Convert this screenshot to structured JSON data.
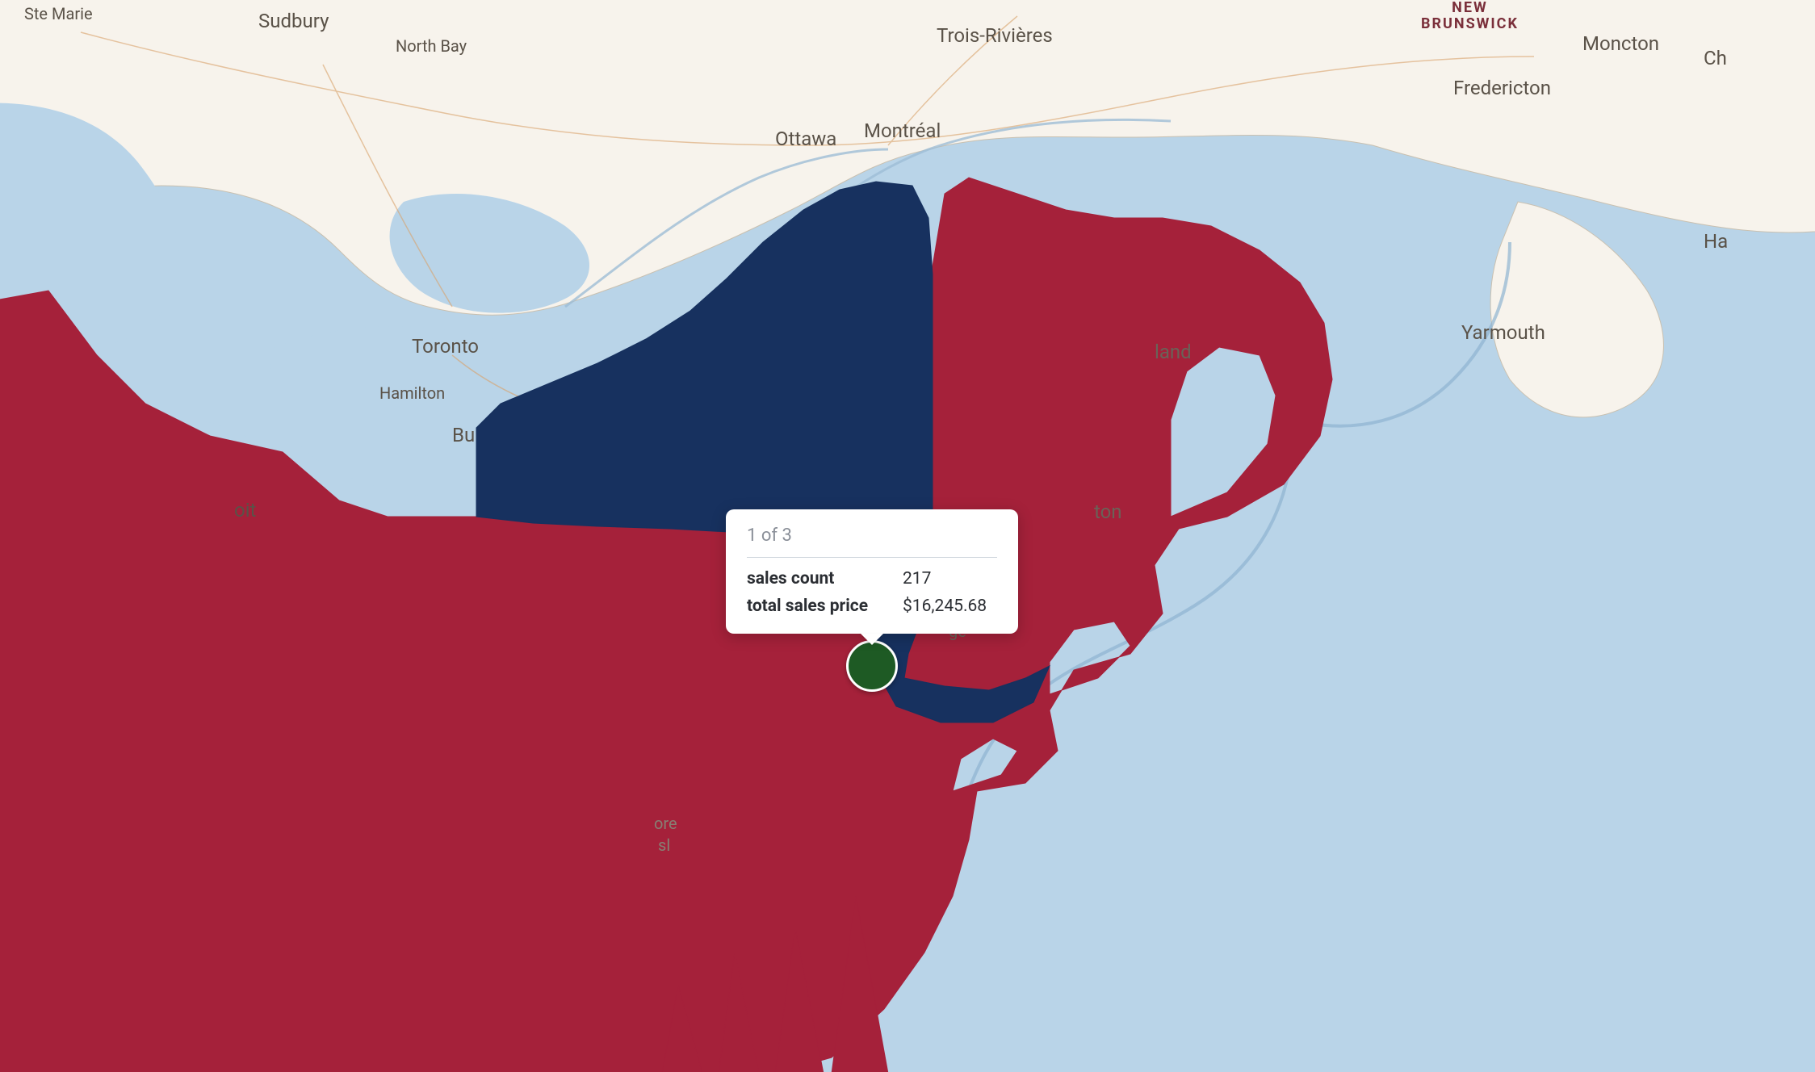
{
  "map": {
    "region_focus": "US Northeast / Eastern Canada",
    "water_color": "#b9d4e8",
    "land_color": "#f7f3ec",
    "overlay_colors": {
      "surrounding_states": "#a5213a",
      "highlighted_state_ny": "#17315f"
    },
    "labels": {
      "ste_marie": "Ste Marie",
      "sudbury": "Sudbury",
      "north_bay": "North Bay",
      "trois_rivieres": "Trois-Rivières",
      "new_brunswick": "NEW\nBRUNSWICK",
      "moncton": "Moncton",
      "fredericton": "Fredericton",
      "ch_fragment": "Ch",
      "ottawa": "Ottawa",
      "montreal": "Montréal",
      "ha_fragment": "Ha",
      "toronto": "Toronto",
      "hamilton": "Hamilton",
      "bu_fragment": "Bu",
      "yarmouth": "Yarmouth",
      "land_fragment": "land",
      "oit_fragment": "oit",
      "ton_fragment": "ton",
      "ge_fragment": "ge",
      "ore_fragment": "ore",
      "sl_fragment": "sl"
    }
  },
  "marker": {
    "name": "sales-marker-new-york-city",
    "color": "#1e5a24"
  },
  "tooltip": {
    "page_indicator": "1 of 3",
    "rows": [
      {
        "label": "sales count",
        "value": "217"
      },
      {
        "label": "total sales price",
        "value": "$16,245.68"
      }
    ]
  }
}
